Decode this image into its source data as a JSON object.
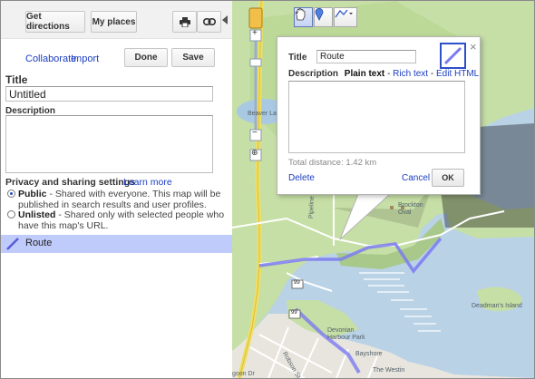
{
  "toolbar": {
    "get_directions": "Get directions",
    "my_places": "My places",
    "print_icon": "printer-icon",
    "link_icon": "link-icon"
  },
  "actions": {
    "collaborate": "Collaborate",
    "import": "Import",
    "done": "Done",
    "save": "Save"
  },
  "form": {
    "title_label": "Title",
    "title_value": "Untitled",
    "description_label": "Description",
    "description_value": ""
  },
  "privacy": {
    "heading": "Privacy and sharing settings",
    "learn_more": "Learn more",
    "options": [
      {
        "title": "Public",
        "text": "- Shared with everyone. This map will be published in search results and user profiles.",
        "checked": true
      },
      {
        "title": "Unlisted",
        "text": "- Shared only with selected people who have this map's URL.",
        "checked": false
      }
    ]
  },
  "layers": [
    {
      "label": "Route",
      "icon": "line-icon",
      "selected": true
    }
  ],
  "map": {
    "labels": {
      "beaver_lake": "Beaver Lake",
      "pipeline": "Pipeline Rd",
      "brockton": "Brockton Oval",
      "devonian": "Devonian Harbour Park",
      "deadman": "Deadman's Island",
      "bayshore": "Bayshore",
      "westin": "The Westin",
      "robson": "Robson St",
      "lagoon": "goon Dr",
      "hwy1": "99",
      "hwy2": "99"
    },
    "tools": [
      "hand-icon",
      "placemark-icon",
      "draw-line-icon"
    ],
    "route_color": "#7b7bf0"
  },
  "info_window": {
    "title_label": "Title",
    "title_value": "Route",
    "description_label": "Description",
    "plain_text": "Plain text",
    "rich_text": "Rich text",
    "edit_html": "Edit HTML",
    "separator": "-",
    "total_distance": "Total distance: 1.42 km",
    "delete": "Delete",
    "cancel": "Cancel",
    "ok": "OK",
    "close": "×"
  }
}
